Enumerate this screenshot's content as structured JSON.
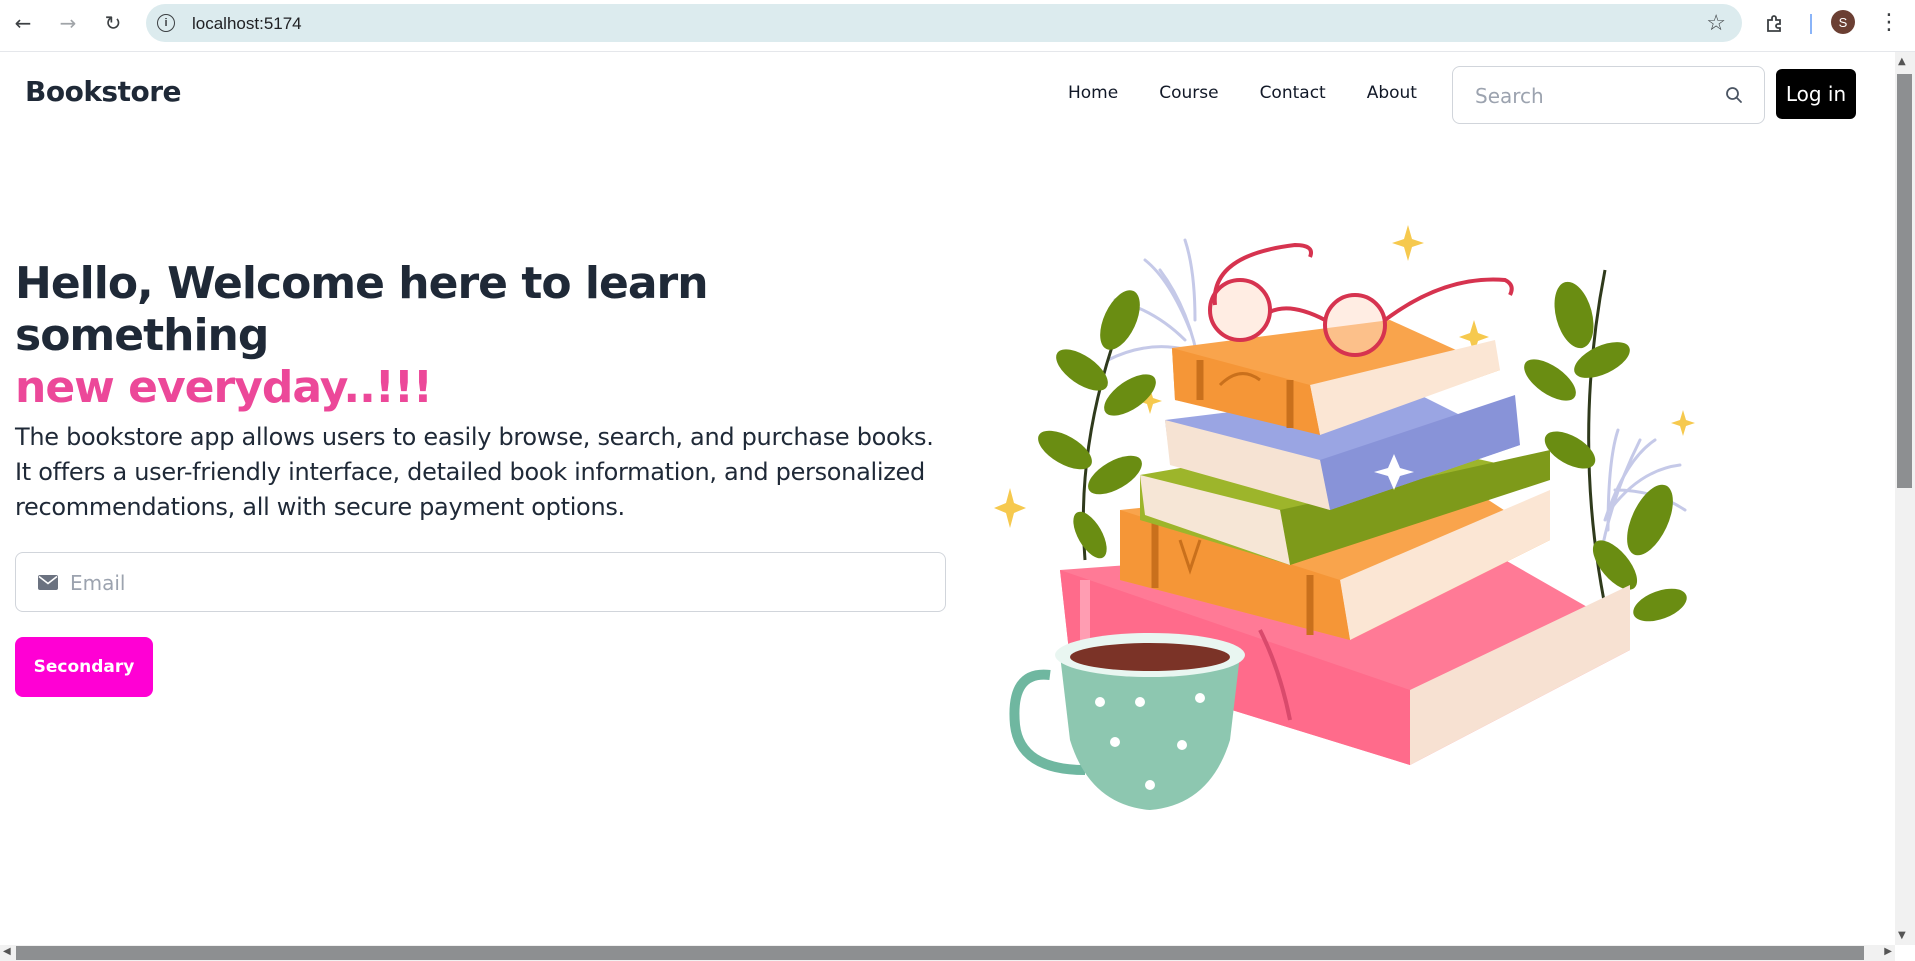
{
  "browser": {
    "url": "localhost:5174",
    "avatar_initial": "S",
    "icons": [
      "back-icon",
      "forward-icon",
      "reload-icon",
      "info-icon",
      "star-icon",
      "extensions-icon",
      "menu-icon"
    ]
  },
  "navbar": {
    "logo": "Bookstore",
    "items": [
      {
        "label": "Home"
      },
      {
        "label": "Course"
      },
      {
        "label": "Contact"
      },
      {
        "label": "About"
      }
    ],
    "search": {
      "placeholder": "Search"
    },
    "login_label": "Log in"
  },
  "hero": {
    "title_line1": "Hello, Welcome here to learn something",
    "title_line2": "new everyday..!!!",
    "description": "The bookstore app allows users to easily browse, search, and purchase books. It offers a user-friendly interface, detailed book information, and personalized recommendations, all with secure payment options.",
    "email": {
      "placeholder": "Email"
    },
    "button_label": "Secondary"
  },
  "colors": {
    "accent_pink": "#ec4899",
    "button_magenta": "#ff00d4",
    "login_black": "#000000",
    "text_dark": "#1f2937"
  }
}
